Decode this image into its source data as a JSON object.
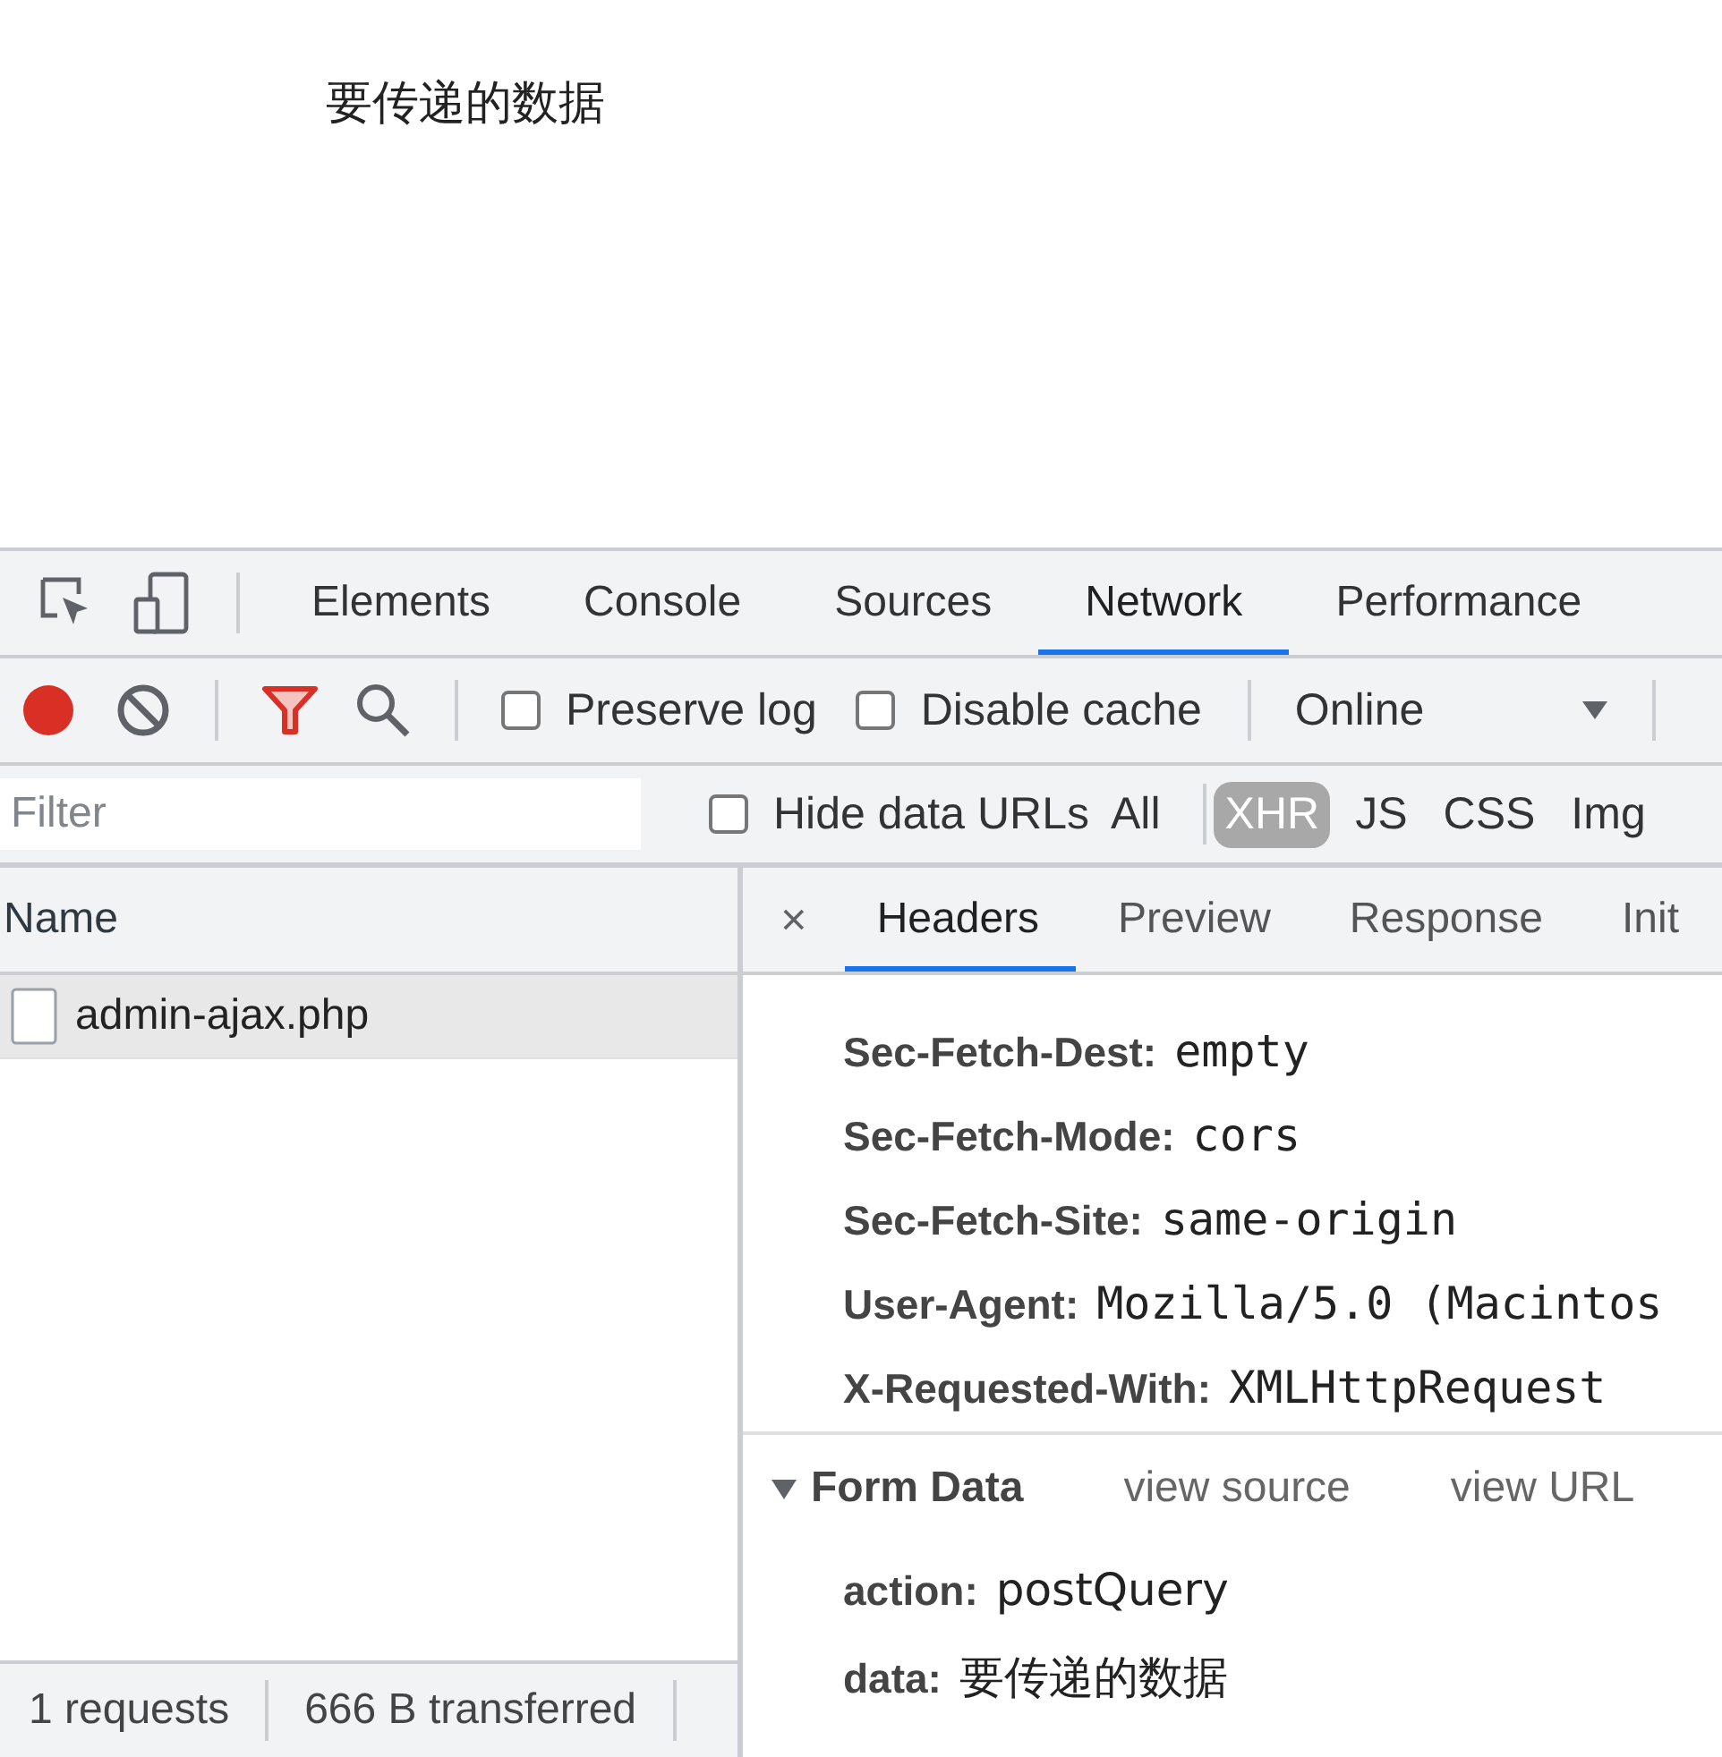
{
  "page": {
    "text": "要传递的数据"
  },
  "tabs": [
    {
      "label": "Elements",
      "selected": false
    },
    {
      "label": "Console",
      "selected": false
    },
    {
      "label": "Sources",
      "selected": false
    },
    {
      "label": "Network",
      "selected": true
    },
    {
      "label": "Performance",
      "selected": false
    }
  ],
  "network_toolbar": {
    "recording": true,
    "checkboxes": [
      {
        "label": "Preserve log",
        "checked": false
      },
      {
        "label": "Disable cache",
        "checked": false
      }
    ],
    "throttling": "Online"
  },
  "filter_bar": {
    "placeholder": "Filter",
    "hide_data_urls": {
      "label": "Hide data URLs",
      "checked": false
    },
    "types": [
      {
        "label": "All",
        "selected": false
      },
      {
        "label": "XHR",
        "selected": true
      },
      {
        "label": "JS",
        "selected": false
      },
      {
        "label": "CSS",
        "selected": false
      },
      {
        "label": "Img",
        "selected": false
      }
    ]
  },
  "requests": {
    "column": "Name",
    "rows": [
      {
        "name": "admin-ajax.php",
        "selected": true
      }
    ]
  },
  "details": {
    "tabs": [
      {
        "label": "Headers",
        "selected": true
      },
      {
        "label": "Preview",
        "selected": false
      },
      {
        "label": "Response",
        "selected": false
      },
      {
        "label": "Init",
        "selected": false
      }
    ],
    "headers": [
      {
        "name": "Sec-Fetch-Dest:",
        "value": "empty"
      },
      {
        "name": "Sec-Fetch-Mode:",
        "value": "cors"
      },
      {
        "name": "Sec-Fetch-Site:",
        "value": "same-origin"
      },
      {
        "name": "User-Agent:",
        "value": "Mozilla/5.0 (Macintos"
      },
      {
        "name": "X-Requested-With:",
        "value": "XMLHttpRequest"
      }
    ],
    "form_data": {
      "title": "Form Data",
      "expanded": true,
      "links": [
        "view source",
        "view URL"
      ],
      "fields": [
        {
          "name": "action:",
          "value": "postQuery"
        },
        {
          "name": "data:",
          "value": "要传递的数据"
        }
      ]
    }
  },
  "status_bar": [
    "1 requests",
    "666 B transferred"
  ]
}
